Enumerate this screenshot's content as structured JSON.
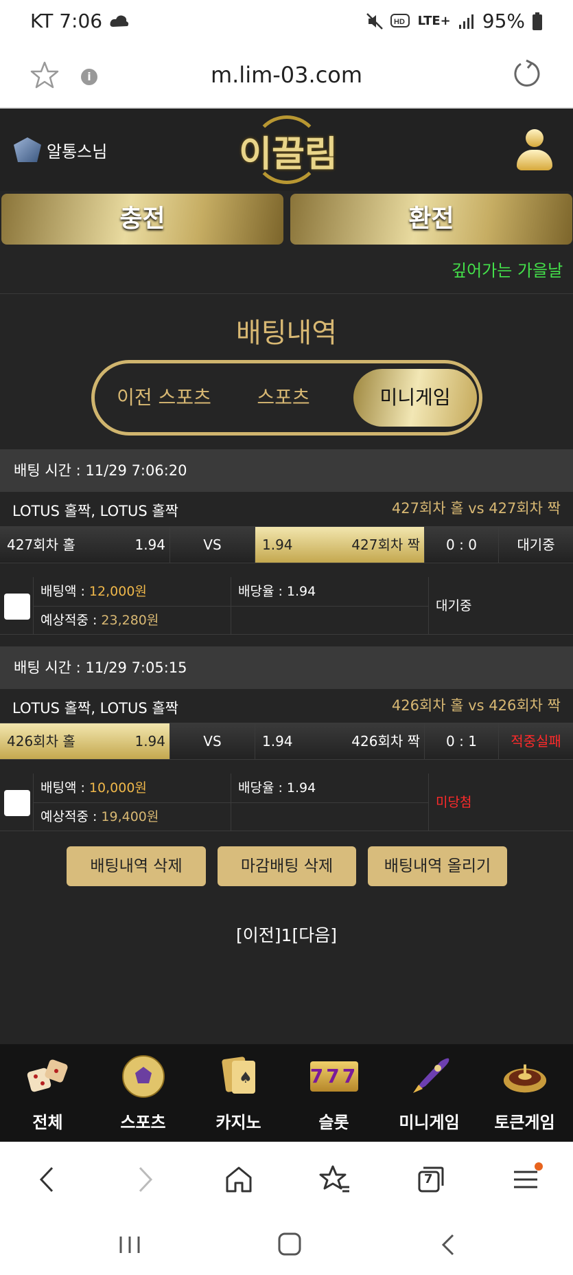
{
  "status_bar": {
    "carrier_time": "KT 7:06",
    "lte": "LTE+",
    "battery": "95%"
  },
  "browser": {
    "url": "m.lim-03.com",
    "tab_count": "7"
  },
  "header": {
    "username": "알통스님",
    "logo_text": "이끌림"
  },
  "buttons": {
    "charge": "충전",
    "exchange": "환전"
  },
  "ticker": {
    "star": "★",
    "text": "깊어가는 가을날"
  },
  "page_title": "배팅내역",
  "tabs": [
    {
      "label": "이전 스포츠"
    },
    {
      "label": "스포츠"
    },
    {
      "label": "미니게임"
    }
  ],
  "bets": [
    {
      "time_label": "배팅 시간 : 11/29 7:06:20",
      "game": "LOTUS 홀짝, LOTUS 홀짝",
      "versus": "427회차 홀  vs  427회차 짝",
      "home_team": "427회차 홀",
      "home_odds": "1.94",
      "vs": "VS",
      "away_odds": "1.94",
      "away_team": "427회차 짝",
      "score": "0 : 0",
      "status": "대기중",
      "stake_label": "배팅액 : ",
      "stake": "12,000원",
      "expected_label": "예상적중 : ",
      "expected": "23,280원",
      "rate_label": "배당율 : ",
      "rate": "1.94",
      "result": "대기중"
    },
    {
      "time_label": "배팅 시간 : 11/29 7:05:15",
      "game": "LOTUS 홀짝, LOTUS 홀짝",
      "versus": "426회차 홀  vs  426회차 짝",
      "home_team": "426회차 홀",
      "home_odds": "1.94",
      "vs": "VS",
      "away_odds": "1.94",
      "away_team": "426회차 짝",
      "score": "0 : 1",
      "status": "적중실패",
      "stake_label": "배팅액 : ",
      "stake": "10,000원",
      "expected_label": "예상적중 : ",
      "expected": "19,400원",
      "rate_label": "배당율 : ",
      "rate": "1.94",
      "result": "미당첨"
    }
  ],
  "actions": {
    "delete": "배팅내역 삭제",
    "delete_closed": "마감배팅 삭제",
    "post": "배팅내역 올리기"
  },
  "pager": "[이전]1[다음]",
  "bottom_nav": [
    {
      "label": "전체"
    },
    {
      "label": "스포츠"
    },
    {
      "label": "카지노"
    },
    {
      "label": "슬롯",
      "icon_text": "777"
    },
    {
      "label": "미니게임"
    },
    {
      "label": "토큰게임"
    }
  ]
}
